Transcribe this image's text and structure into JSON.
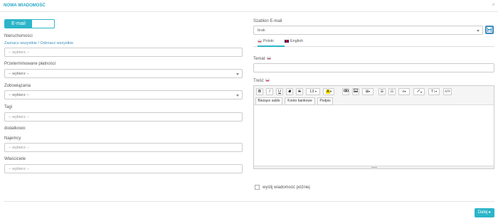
{
  "header": {
    "title": "NOWA WIADOMOŚĆ",
    "close": "×"
  },
  "channel_toggle": {
    "active_label": "E-mail"
  },
  "left": {
    "nieruchomosci": {
      "label": "Nieruchomości",
      "select_all": "Zaznacz wszystkie",
      "separator": " / ",
      "deselect_all": "Odznacz wszystkie",
      "placeholder": "-- wybierz --"
    },
    "przeterminowane": {
      "label": "Przeterminowane płatności",
      "value": "-- wybierz --"
    },
    "zobowiazania": {
      "label": "Zobowiązania",
      "value": "-- wybierz --"
    },
    "tagi": {
      "label": "Tagi",
      "placeholder": "-- wybierz --"
    },
    "dodatkowo": "dodatkowo:",
    "najemcy": {
      "label": "Najemcy",
      "placeholder": "-- wybierz --"
    },
    "wlasciciele": {
      "label": "Właściciele",
      "placeholder": "-- wybierz --"
    }
  },
  "right": {
    "template": {
      "label": "Szablon E-mail",
      "value": "brak"
    },
    "tabs": [
      {
        "label": "Polski",
        "active": true
      },
      {
        "label": "English",
        "active": false
      }
    ],
    "subject": {
      "label": "Temat",
      "value": ""
    },
    "body_label": "Treść",
    "toolbar": {
      "bold": "B",
      "italic": "I",
      "underline": "U",
      "strike": "S",
      "font_size": "13",
      "font_color": "A",
      "table": "⊞",
      "list_ul": "☰",
      "list_ol": "☷",
      "align": "≡",
      "line_height": "T↕",
      "code": "</>"
    },
    "placeholders": [
      "Bieżące saldo",
      "Konto bankowe",
      "Podpis"
    ],
    "send_later": "wyślij wiadomość później"
  },
  "footer": {
    "next_label": "Dalej ▸"
  },
  "colors": {
    "accent": "#2bb5c9",
    "link": "#3c8dbc"
  }
}
